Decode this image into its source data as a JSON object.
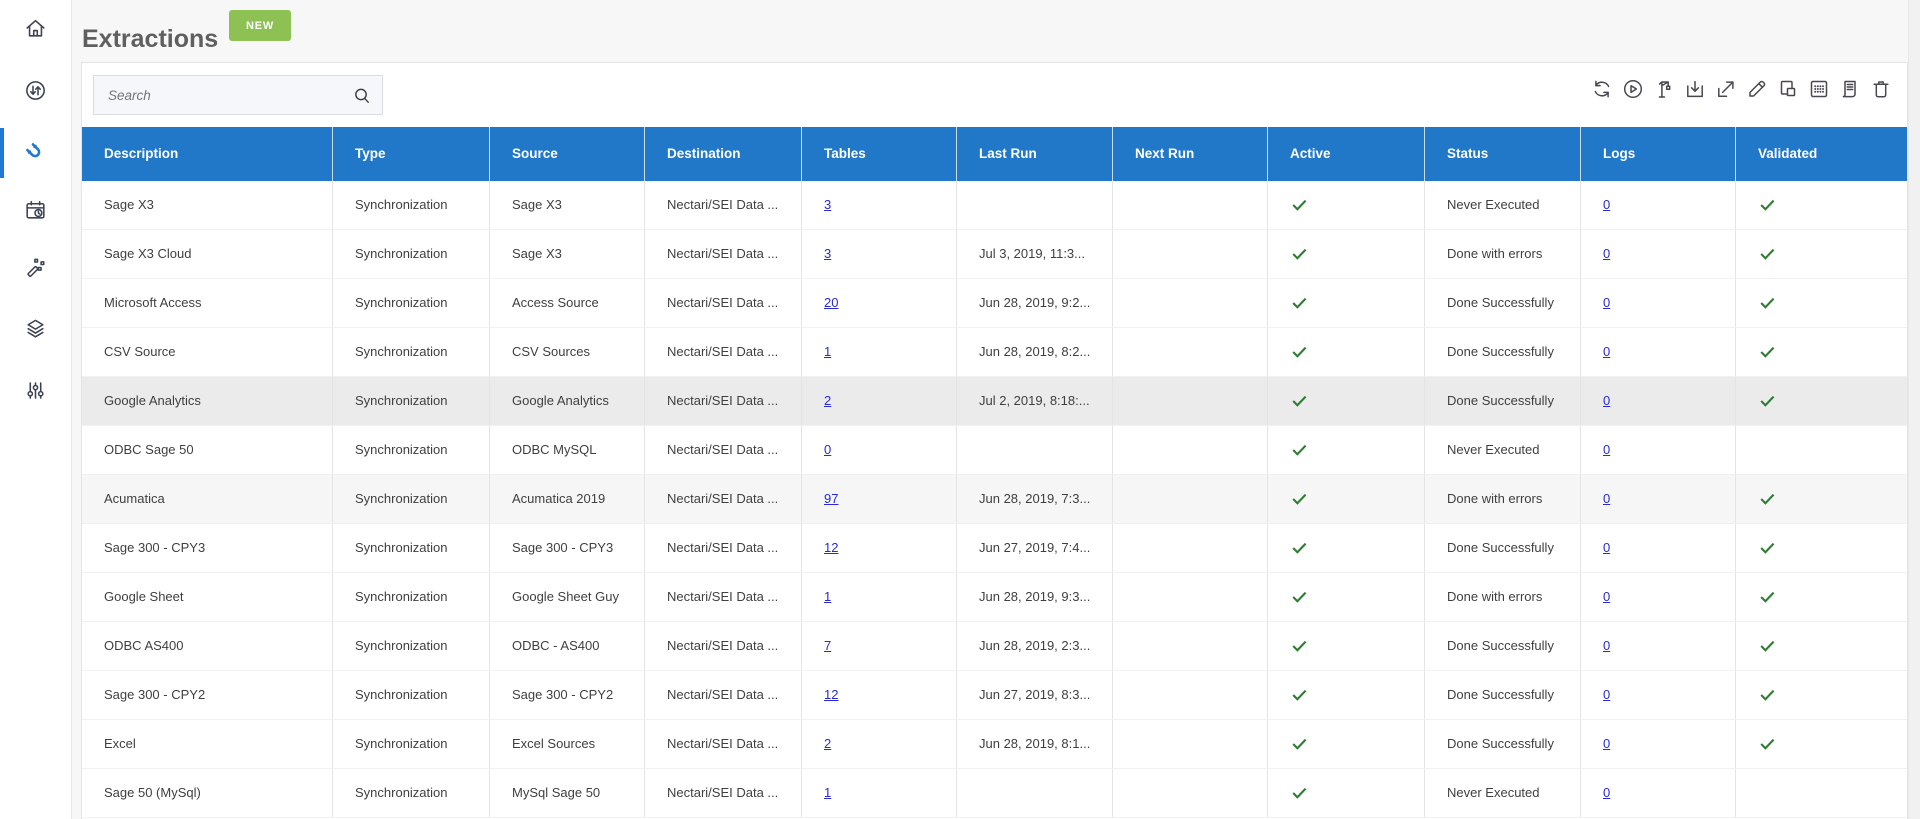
{
  "page": {
    "title": "Extractions",
    "new_button_label": "NEW"
  },
  "colors": {
    "header_blue": "#2278c8",
    "active_sidebar_blue": "#1f79d2",
    "new_button_green": "#8dc153",
    "check_green": "#2e7d32",
    "link_blue": "#2a2ad2"
  },
  "sidebar": {
    "items": [
      {
        "icon": "home-icon",
        "active": false
      },
      {
        "icon": "sync-arrows-icon",
        "active": false
      },
      {
        "icon": "magnet-icon",
        "active": true
      },
      {
        "icon": "calendar-clock-icon",
        "active": false
      },
      {
        "icon": "magic-wand-icon",
        "active": false
      },
      {
        "icon": "layers-icon",
        "active": false
      },
      {
        "icon": "sliders-icon",
        "active": false
      }
    ]
  },
  "search": {
    "placeholder": "Search",
    "value": ""
  },
  "toolbar": {
    "icons": [
      "refresh-icon",
      "run-icon",
      "crane-icon",
      "download-icon",
      "export-icon",
      "edit-icon",
      "copy-icon",
      "grid-icon",
      "log-icon",
      "delete-icon"
    ]
  },
  "table": {
    "columns": [
      "Description",
      "Type",
      "Source",
      "Destination",
      "Tables",
      "Last Run",
      "Next Run",
      "Active",
      "Status",
      "Logs",
      "Validated"
    ],
    "rows": [
      {
        "description": "Sage X3",
        "type": "Synchronization",
        "source": "Sage X3",
        "destination": "Nectari/SEI Data ...",
        "tables": "3",
        "last_run": "",
        "next_run": "",
        "active": true,
        "status": "Never Executed",
        "logs": "0",
        "validated": true,
        "shade": ""
      },
      {
        "description": "Sage X3 Cloud",
        "type": "Synchronization",
        "source": "Sage X3",
        "destination": "Nectari/SEI Data ...",
        "tables": "3",
        "last_run": "Jul 3, 2019, 11:3...",
        "next_run": "",
        "active": true,
        "status": "Done with errors",
        "logs": "0",
        "validated": true,
        "shade": ""
      },
      {
        "description": "Microsoft Access",
        "type": "Synchronization",
        "source": "Access Source",
        "destination": "Nectari/SEI Data ...",
        "tables": "20",
        "last_run": "Jun 28, 2019, 9:2...",
        "next_run": "",
        "active": true,
        "status": "Done Successfully",
        "logs": "0",
        "validated": true,
        "shade": ""
      },
      {
        "description": "CSV Source",
        "type": "Synchronization",
        "source": "CSV Sources",
        "destination": "Nectari/SEI Data ...",
        "tables": "1",
        "last_run": "Jun 28, 2019, 8:2...",
        "next_run": "",
        "active": true,
        "status": "Done Successfully",
        "logs": "0",
        "validated": true,
        "shade": ""
      },
      {
        "description": "Google Analytics",
        "type": "Synchronization",
        "source": "Google Analytics",
        "destination": "Nectari/SEI Data ...",
        "tables": "2",
        "last_run": "Jul 2, 2019, 8:18:...",
        "next_run": "",
        "active": true,
        "status": "Done Successfully",
        "logs": "0",
        "validated": true,
        "shade": "dark"
      },
      {
        "description": "ODBC Sage 50",
        "type": "Synchronization",
        "source": "ODBC MySQL",
        "destination": "Nectari/SEI Data ...",
        "tables": "0",
        "last_run": "",
        "next_run": "",
        "active": true,
        "status": "Never Executed",
        "logs": "0",
        "validated": false,
        "shade": ""
      },
      {
        "description": "Acumatica",
        "type": "Synchronization",
        "source": "Acumatica 2019",
        "destination": "Nectari/SEI Data ...",
        "tables": "97",
        "last_run": "Jun 28, 2019, 7:3...",
        "next_run": "",
        "active": true,
        "status": "Done with errors",
        "logs": "0",
        "validated": true,
        "shade": "light"
      },
      {
        "description": "Sage 300 - CPY3",
        "type": "Synchronization",
        "source": "Sage 300 - CPY3",
        "destination": "Nectari/SEI Data ...",
        "tables": "12",
        "last_run": "Jun 27, 2019, 7:4...",
        "next_run": "",
        "active": true,
        "status": "Done Successfully",
        "logs": "0",
        "validated": true,
        "shade": ""
      },
      {
        "description": "Google Sheet",
        "type": "Synchronization",
        "source": "Google Sheet Guy",
        "destination": "Nectari/SEI Data ...",
        "tables": "1",
        "last_run": "Jun 28, 2019, 9:3...",
        "next_run": "",
        "active": true,
        "status": "Done with errors",
        "logs": "0",
        "validated": true,
        "shade": ""
      },
      {
        "description": "ODBC AS400",
        "type": "Synchronization",
        "source": "ODBC - AS400",
        "destination": "Nectari/SEI Data ...",
        "tables": "7",
        "last_run": "Jun 28, 2019, 2:3...",
        "next_run": "",
        "active": true,
        "status": "Done Successfully",
        "logs": "0",
        "validated": true,
        "shade": ""
      },
      {
        "description": "Sage 300 - CPY2",
        "type": "Synchronization",
        "source": "Sage 300 - CPY2",
        "destination": "Nectari/SEI Data ...",
        "tables": "12",
        "last_run": "Jun 27, 2019, 8:3...",
        "next_run": "",
        "active": true,
        "status": "Done Successfully",
        "logs": "0",
        "validated": true,
        "shade": ""
      },
      {
        "description": "Excel",
        "type": "Synchronization",
        "source": "Excel Sources",
        "destination": "Nectari/SEI Data ...",
        "tables": "2",
        "last_run": "Jun 28, 2019, 8:1...",
        "next_run": "",
        "active": true,
        "status": "Done Successfully",
        "logs": "0",
        "validated": true,
        "shade": ""
      },
      {
        "description": "Sage 50 (MySql)",
        "type": "Synchronization",
        "source": "MySql Sage 50",
        "destination": "Nectari/SEI Data ...",
        "tables": "1",
        "last_run": "",
        "next_run": "",
        "active": true,
        "status": "Never Executed",
        "logs": "0",
        "validated": false,
        "shade": ""
      }
    ]
  }
}
